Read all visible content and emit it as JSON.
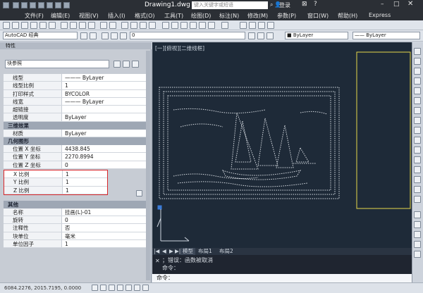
{
  "title_bar": {
    "document": "Drawing1.dwg",
    "search_placeholder": "键入关键字或短语",
    "login": "登录"
  },
  "menu": [
    "文件(F)",
    "编辑(E)",
    "视图(V)",
    "插入(I)",
    "格式(O)",
    "工具(T)",
    "绘图(D)",
    "标注(N)",
    "修改(M)",
    "参数(P)",
    "窗口(W)",
    "帮助(H)",
    "Express"
  ],
  "toolbar": {
    "workspace": "AutoCAD 经典",
    "layer_value": "0",
    "color": "ByLayer",
    "linetype": "ByLayer"
  },
  "properties_panel": {
    "title": "特性",
    "selection": "块参照",
    "rows_top": [
      {
        "key": "线型",
        "value": "——— ByLayer"
      },
      {
        "key": "线型比例",
        "value": "1"
      },
      {
        "key": "打印样式",
        "value": "BYCOLOR"
      },
      {
        "key": "线宽",
        "value": "——— ByLayer"
      },
      {
        "key": "超链接",
        "value": ""
      },
      {
        "key": "透明度",
        "value": "ByLayer"
      }
    ],
    "section_3d": "三维效果",
    "row_material": {
      "key": "材质",
      "value": "ByLayer"
    },
    "section_geometry": "几何图形",
    "rows_geometry": [
      {
        "key": "位置 X 坐标",
        "value": "4438.845"
      },
      {
        "key": "位置 Y 坐标",
        "value": "2270.8994"
      },
      {
        "key": "位置 Z 坐标",
        "value": "0"
      }
    ],
    "rows_scale": [
      {
        "key": "X 比例",
        "value": "1"
      },
      {
        "key": "Y 比例",
        "value": "1"
      },
      {
        "key": "Z 比例",
        "value": "1"
      }
    ],
    "section_misc": "其他",
    "rows_misc": [
      {
        "key": "名称",
        "value": "挂画(L)-01"
      },
      {
        "key": "旋转",
        "value": "0"
      },
      {
        "key": "注释性",
        "value": "否"
      },
      {
        "key": "块单位",
        "value": "毫米"
      },
      {
        "key": "单位因子",
        "value": "1"
      }
    ]
  },
  "viewport": {
    "label": "[一][俯视][二维线框]"
  },
  "layout_tabs": [
    "模型",
    "布局1",
    "布局2"
  ],
  "command": {
    "history": "；错误：函数被取消",
    "line2": "命令：",
    "prompt": "命令："
  },
  "status_bar": {
    "coords": "6084.2276, 2015.7195, 0.0000"
  }
}
